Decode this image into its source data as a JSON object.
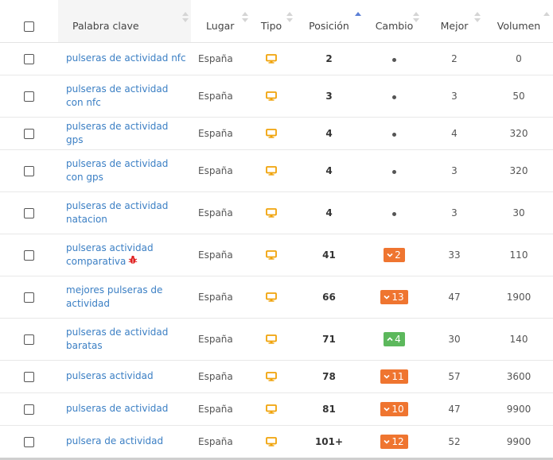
{
  "headers": {
    "keyword": "Palabra clave",
    "place": "Lugar",
    "type": "Tipo",
    "position": "Posición",
    "change": "Cambio",
    "best": "Mejor",
    "volume": "Volumen"
  },
  "colors": {
    "link": "#3b7fc4",
    "monitor_icon": "#f0a30a",
    "badge_down": "#ef7530",
    "badge_up": "#5cb85c",
    "bug_icon": "#e02020",
    "sort_active": "#5b7fd6"
  },
  "icons": {
    "type": "desktop-monitor-icon",
    "neutral_change": "dot-icon",
    "down": "chevron-down-icon",
    "up": "chevron-up-icon",
    "warning": "bug-icon"
  },
  "rows": [
    {
      "keyword": "pulseras de actividad nfc",
      "place": "España",
      "position": "2",
      "change": {
        "kind": "none"
      },
      "best": "2",
      "volume": "0"
    },
    {
      "keyword": "pulseras de actividad con nfc",
      "place": "España",
      "position": "3",
      "change": {
        "kind": "none"
      },
      "best": "3",
      "volume": "50"
    },
    {
      "keyword": "pulseras de actividad gps",
      "place": "España",
      "position": "4",
      "change": {
        "kind": "none"
      },
      "best": "4",
      "volume": "320"
    },
    {
      "keyword": "pulseras de actividad con gps",
      "place": "España",
      "position": "4",
      "change": {
        "kind": "none"
      },
      "best": "3",
      "volume": "320"
    },
    {
      "keyword": "pulseras de actividad natacion",
      "place": "España",
      "position": "4",
      "change": {
        "kind": "none"
      },
      "best": "3",
      "volume": "30"
    },
    {
      "keyword": "pulseras actividad comparativa",
      "bug": true,
      "place": "España",
      "position": "41",
      "change": {
        "kind": "down",
        "value": "2"
      },
      "best": "33",
      "volume": "110"
    },
    {
      "keyword": "mejores pulseras de actividad",
      "place": "España",
      "position": "66",
      "change": {
        "kind": "down",
        "value": "13"
      },
      "best": "47",
      "volume": "1900"
    },
    {
      "keyword": "pulseras de actividad baratas",
      "place": "España",
      "position": "71",
      "change": {
        "kind": "up",
        "value": "4"
      },
      "best": "30",
      "volume": "140"
    },
    {
      "keyword": "pulseras actividad",
      "place": "España",
      "position": "78",
      "change": {
        "kind": "down",
        "value": "11"
      },
      "best": "57",
      "volume": "3600"
    },
    {
      "keyword": "pulseras de actividad",
      "place": "España",
      "position": "81",
      "change": {
        "kind": "down",
        "value": "10"
      },
      "best": "47",
      "volume": "9900"
    },
    {
      "keyword": "pulsera de actividad",
      "place": "España",
      "position": "101+",
      "change": {
        "kind": "down",
        "value": "12"
      },
      "best": "52",
      "volume": "9900"
    }
  ]
}
